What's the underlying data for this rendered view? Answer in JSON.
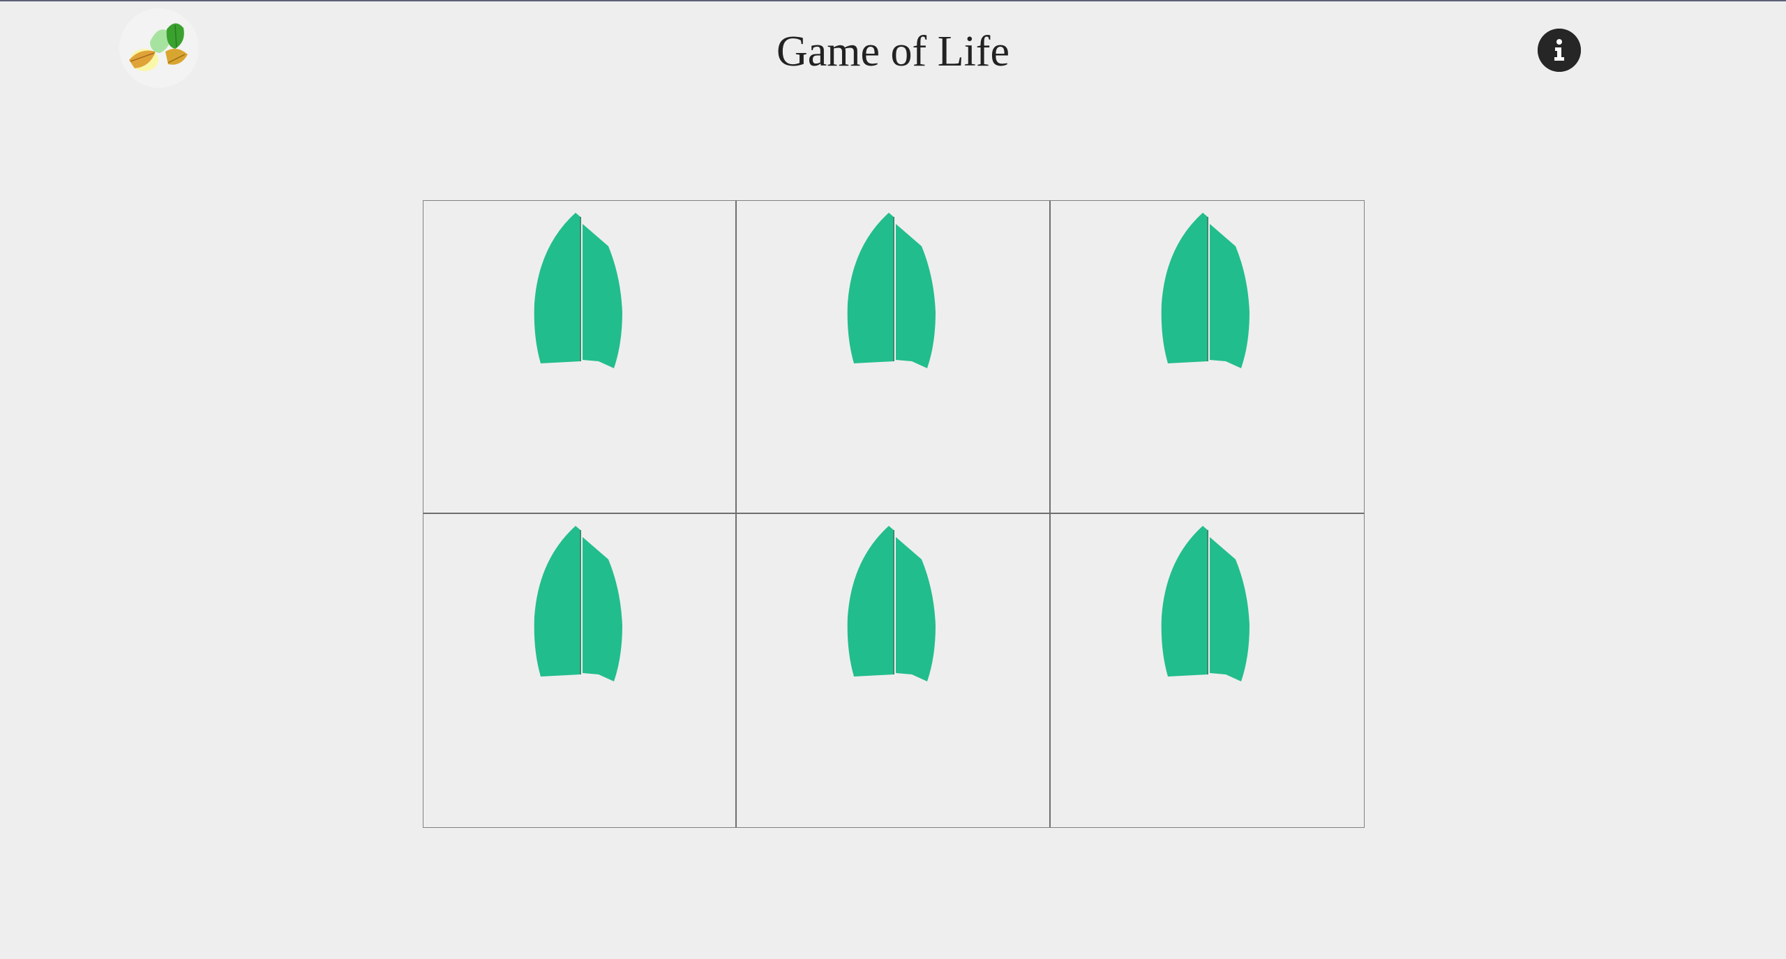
{
  "header": {
    "title": "Game of Life",
    "logo_icon": "leaves-logo-icon",
    "info_icon": "info-icon"
  },
  "board": {
    "rows": 2,
    "cols": 3,
    "cells": [
      {
        "row": 1,
        "col": 1,
        "state": "alive",
        "icon": "leaf-icon"
      },
      {
        "row": 1,
        "col": 2,
        "state": "alive",
        "icon": "leaf-icon"
      },
      {
        "row": 1,
        "col": 3,
        "state": "alive",
        "icon": "leaf-icon"
      },
      {
        "row": 2,
        "col": 1,
        "state": "alive",
        "icon": "leaf-icon"
      },
      {
        "row": 2,
        "col": 2,
        "state": "alive",
        "icon": "leaf-icon"
      },
      {
        "row": 2,
        "col": 3,
        "state": "alive",
        "icon": "leaf-icon"
      }
    ]
  },
  "colors": {
    "background": "#eeeeee",
    "leaf": "#22bd8c",
    "leaf_vein": "#3a8a6e",
    "grid_line": "#6e6e6e",
    "info_button": "#262626",
    "title_text": "#222222"
  }
}
